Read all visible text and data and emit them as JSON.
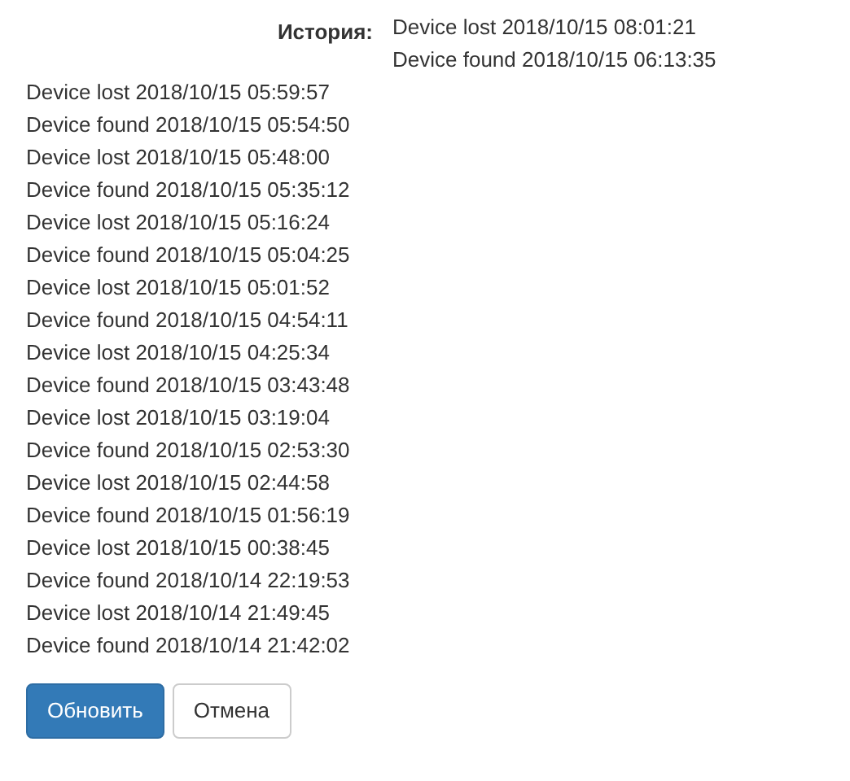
{
  "history": {
    "label": "История:",
    "entries": [
      "Device lost 2018/10/15 08:01:21",
      "Device found 2018/10/15 06:13:35",
      "Device lost 2018/10/15 05:59:57",
      "Device found 2018/10/15 05:54:50",
      "Device lost 2018/10/15 05:48:00",
      "Device found 2018/10/15 05:35:12",
      "Device lost 2018/10/15 05:16:24",
      "Device found 2018/10/15 05:04:25",
      "Device lost 2018/10/15 05:01:52",
      "Device found 2018/10/15 04:54:11",
      "Device lost 2018/10/15 04:25:34",
      "Device found 2018/10/15 03:43:48",
      "Device lost 2018/10/15 03:19:04",
      "Device found 2018/10/15 02:53:30",
      "Device lost 2018/10/15 02:44:58",
      "Device found 2018/10/15 01:56:19",
      "Device lost 2018/10/15 00:38:45",
      "Device found 2018/10/14 22:19:53",
      "Device lost 2018/10/14 21:49:45",
      "Device found 2018/10/14 21:42:02"
    ]
  },
  "buttons": [
    {
      "label": "Обновить",
      "kind": "primary"
    },
    {
      "label": "Отмена",
      "kind": "default"
    }
  ]
}
